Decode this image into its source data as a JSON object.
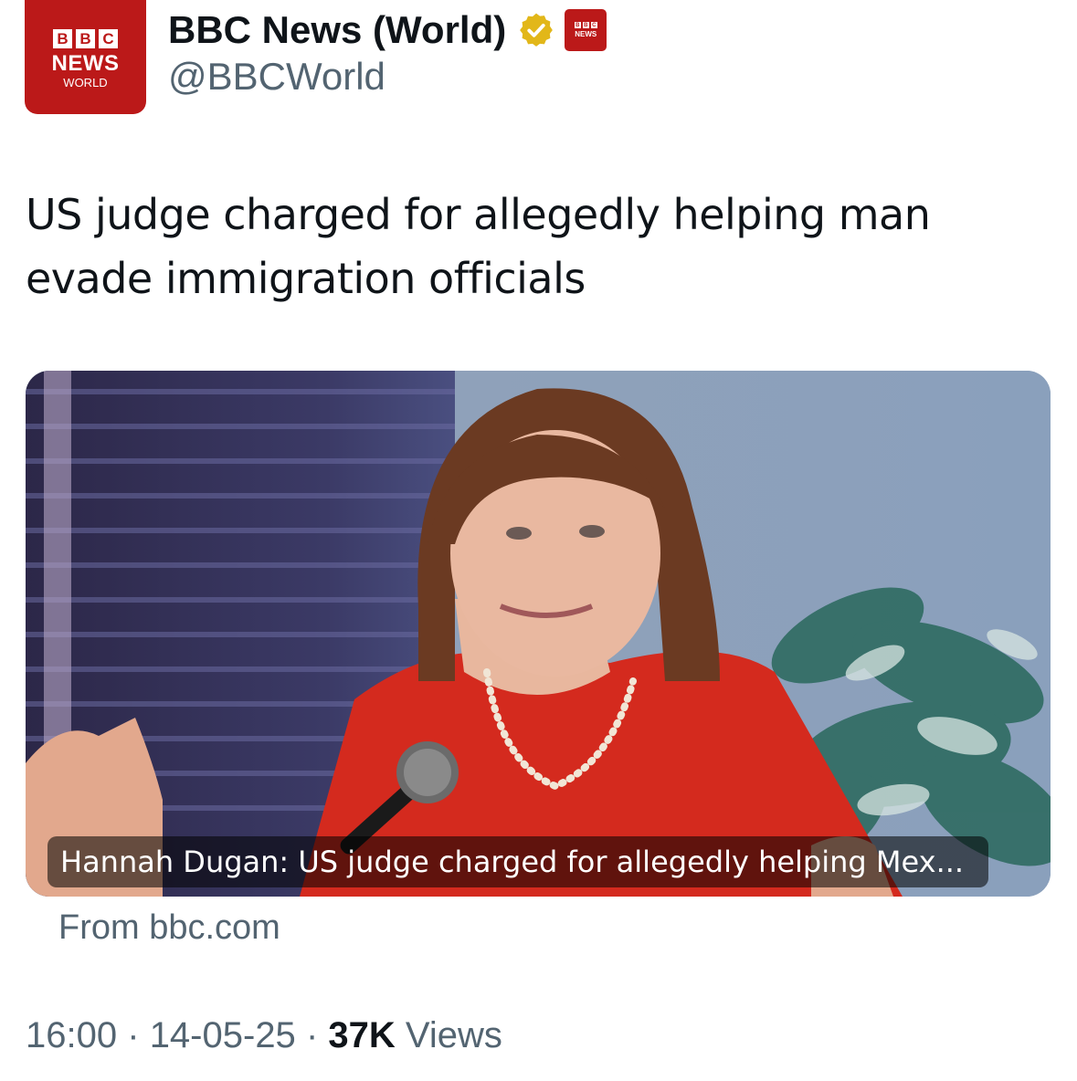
{
  "account": {
    "avatar": {
      "blocks": [
        "B",
        "B",
        "C"
      ],
      "line1": "NEWS",
      "line2": "WORLD"
    },
    "display_name": "BBC News (World)",
    "verified_icon": "verified-gold-check-icon",
    "affiliate_badge": {
      "blocks": [
        "B",
        "B",
        "C"
      ],
      "line": "NEWS"
    },
    "handle": "@BBCWorld"
  },
  "tweet": {
    "text": "US judge charged for allegedly helping man evade immigration officials"
  },
  "link_card": {
    "caption": "Hannah Dugan: US judge charged for allegedly helping Mex...",
    "source": "From bbc.com"
  },
  "meta": {
    "time": "16:00",
    "separator": "·",
    "date": "14-05-25",
    "views_count": "37K",
    "views_label": "Views"
  },
  "colors": {
    "bbc_red": "#bb1919",
    "verified_gold": "#e2b719",
    "secondary_text": "#536471",
    "primary_text": "#0f1419"
  }
}
